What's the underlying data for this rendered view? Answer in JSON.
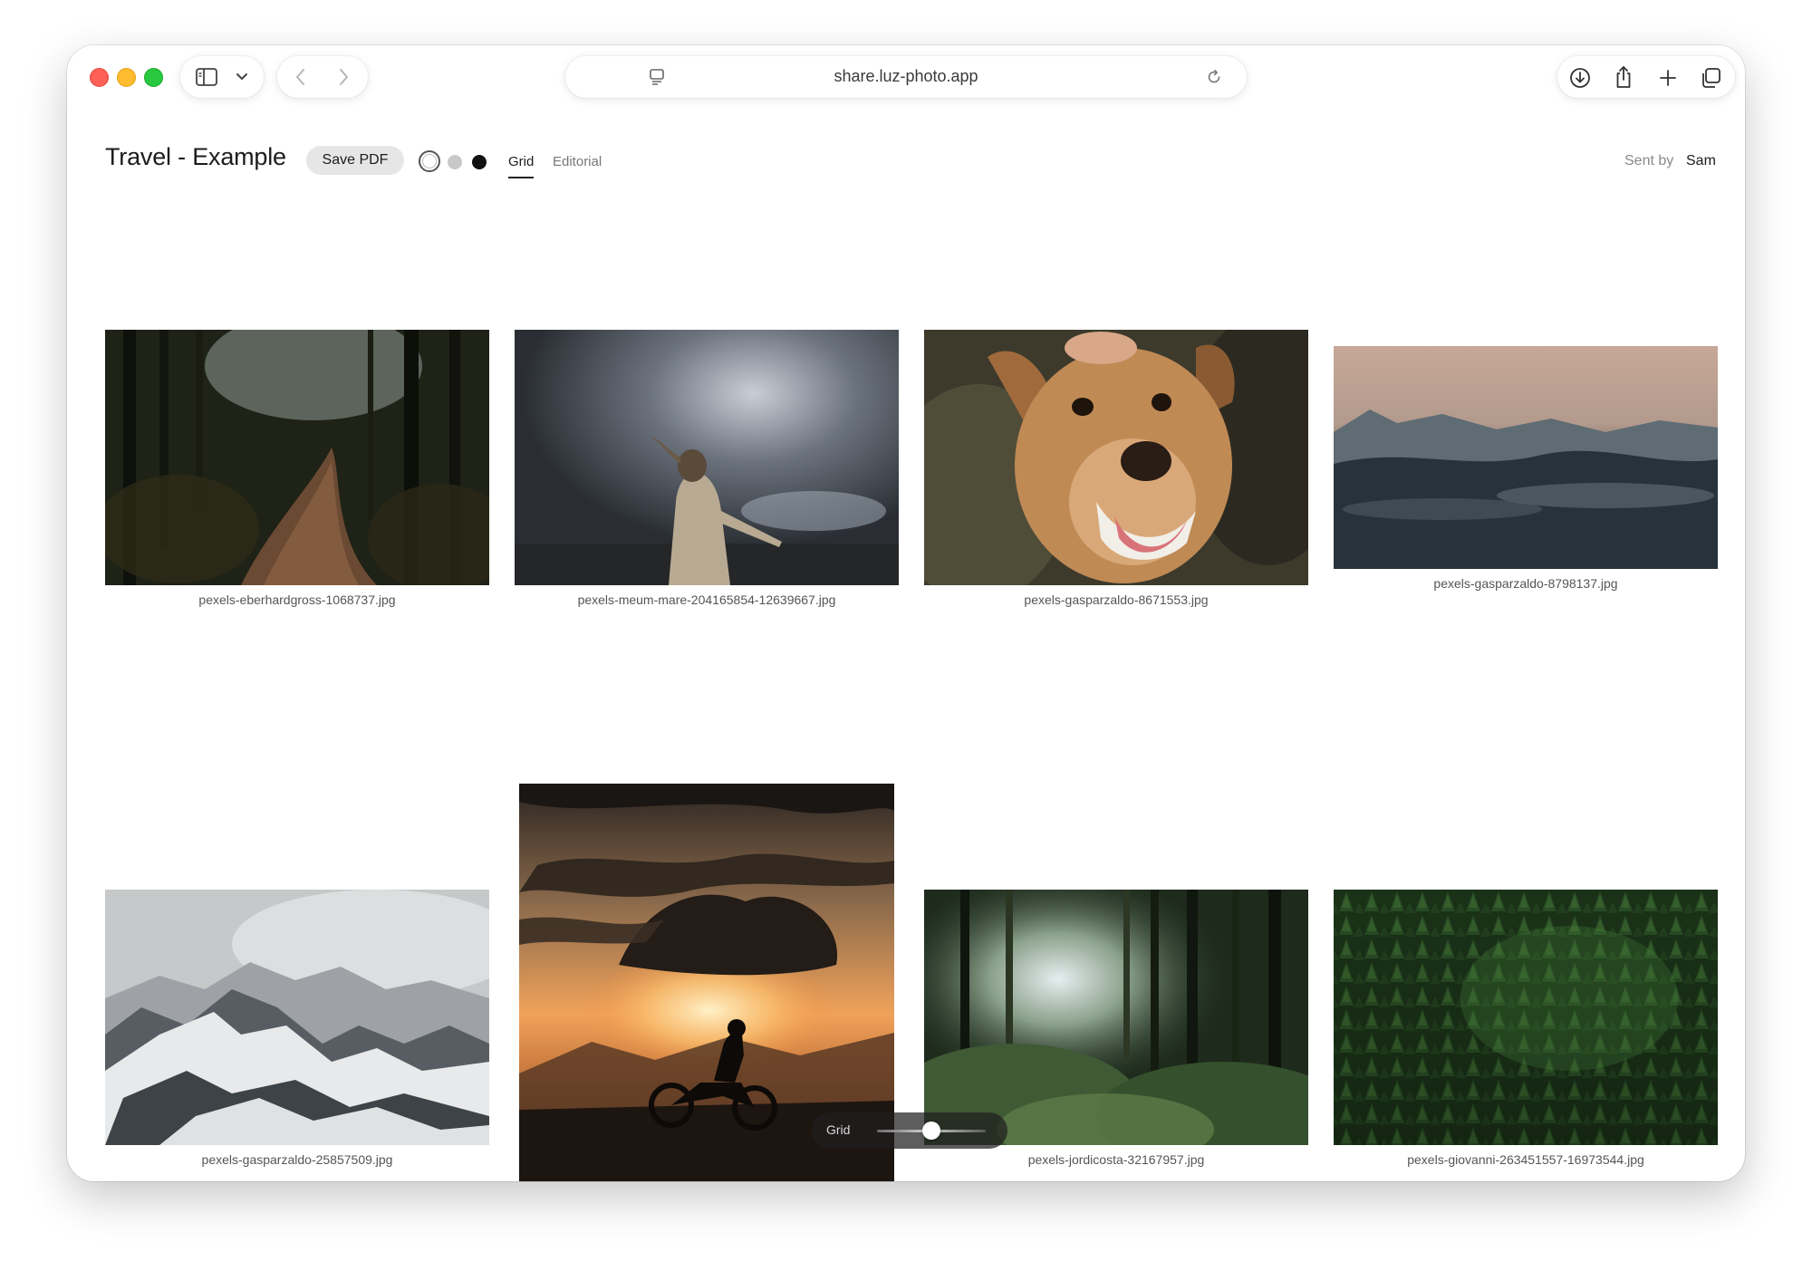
{
  "browser": {
    "url": "share.luz-photo.app",
    "icons": [
      "sidebar-icon",
      "chevron-down-icon",
      "back-icon",
      "forward-icon",
      "page-menu-icon",
      "reload-icon",
      "download-icon",
      "share-icon",
      "new-tab-icon",
      "tab-overview-icon"
    ]
  },
  "header": {
    "title": "Travel - Example",
    "save_label": "Save PDF",
    "swatches": [
      "#ffffff",
      "#c8c8c8",
      "#111111"
    ],
    "tabs": [
      {
        "label": "Grid",
        "active": true
      },
      {
        "label": "Editorial",
        "active": false
      }
    ],
    "sent_by_label": "Sent by",
    "sent_by_name": "Sam"
  },
  "photos": [
    {
      "caption": "pexels-eberhardgross-1068737.jpg"
    },
    {
      "caption": "pexels-meum-mare-204165854-12639667.jpg"
    },
    {
      "caption": "pexels-gasparzaldo-8671553.jpg"
    },
    {
      "caption": "pexels-gasparzaldo-8798137.jpg"
    },
    {
      "caption": "pexels-gasparzaldo-25857509.jpg"
    },
    {
      "caption": "pexels-giovanni-263451557-16973544.jpg"
    },
    {
      "caption": "pexels-jordicosta-32167957.jpg"
    }
  ],
  "slider": {
    "label": "Grid",
    "value": 0.5
  }
}
